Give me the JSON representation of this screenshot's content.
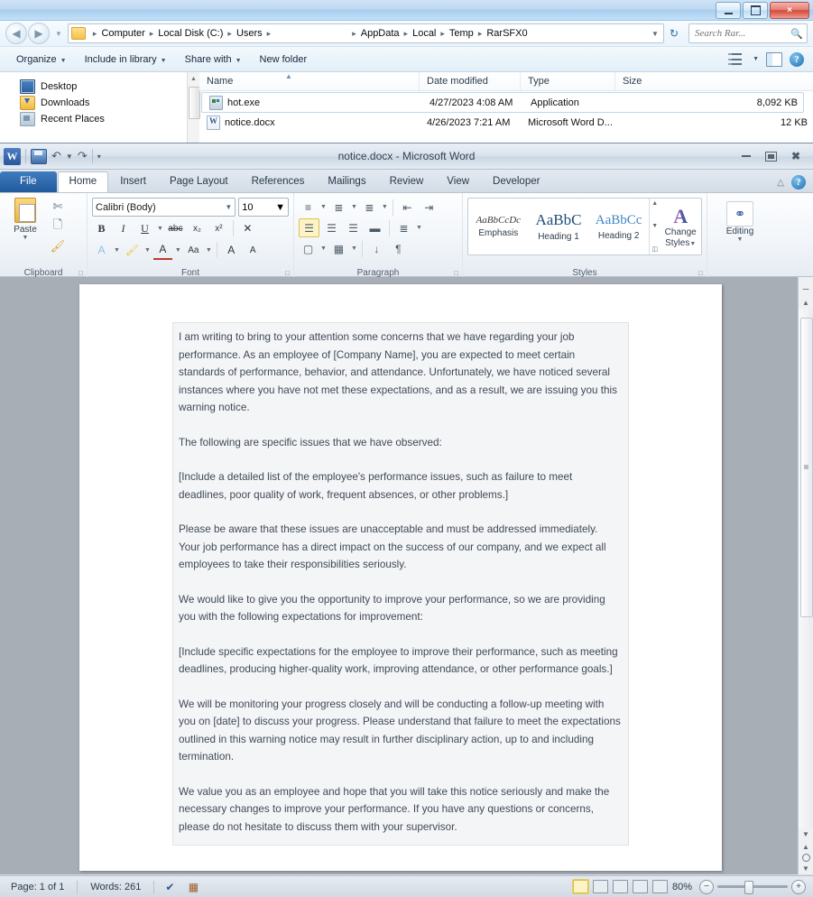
{
  "explorer": {
    "window_buttons": {
      "minimize": "minimize-button",
      "maximize": "maximize-button",
      "close": "×"
    },
    "breadcrumb": {
      "items": [
        "Computer",
        "Local Disk (C:)",
        "Users",
        "AppData",
        "Local",
        "Temp",
        "RarSFX0"
      ],
      "separator": "▸"
    },
    "search": {
      "placeholder": "Search Rar...",
      "value": ""
    },
    "toolbar": {
      "items": [
        {
          "label": "Organize",
          "has_caret": true
        },
        {
          "label": "Include in library",
          "has_caret": true
        },
        {
          "label": "Share with",
          "has_caret": true
        },
        {
          "label": "New folder",
          "has_caret": false
        }
      ],
      "help_label": "?"
    },
    "sidebar": {
      "items": [
        {
          "label": "Desktop",
          "icon": "desktop-icon"
        },
        {
          "label": "Downloads",
          "icon": "downloads-folder-icon"
        },
        {
          "label": "Recent Places",
          "icon": "recent-places-icon"
        }
      ]
    },
    "file_list": {
      "columns": [
        "Name",
        "Date modified",
        "Type",
        "Size"
      ],
      "rows": [
        {
          "name": "hot.exe",
          "date": "4/27/2023 4:08 AM",
          "type": "Application",
          "size": "8,092 KB",
          "icon": "executable-file-icon",
          "selected": true
        },
        {
          "name": "notice.docx",
          "date": "4/26/2023 7:21 AM",
          "type": "Microsoft Word D...",
          "size": "12 KB",
          "icon": "word-document-icon",
          "selected": false
        }
      ]
    }
  },
  "word": {
    "title": "notice.docx - Microsoft Word",
    "logo": "W",
    "quick_access": [
      "save-icon",
      "undo-icon",
      "redo-icon",
      "customize-icon"
    ],
    "tabs": [
      {
        "label": "File",
        "active": false,
        "is_file": true
      },
      {
        "label": "Home",
        "active": true,
        "is_file": false
      },
      {
        "label": "Insert",
        "active": false,
        "is_file": false
      },
      {
        "label": "Page Layout",
        "active": false,
        "is_file": false
      },
      {
        "label": "References",
        "active": false,
        "is_file": false
      },
      {
        "label": "Mailings",
        "active": false,
        "is_file": false
      },
      {
        "label": "Review",
        "active": false,
        "is_file": false
      },
      {
        "label": "View",
        "active": false,
        "is_file": false
      },
      {
        "label": "Developer",
        "active": false,
        "is_file": false
      }
    ],
    "ribbon": {
      "clipboard": {
        "group_label": "Clipboard",
        "paste_label": "Paste",
        "cut": "cut-icon",
        "copy": "copy-icon",
        "format_painter": "format-painter-icon"
      },
      "font": {
        "group_label": "Font",
        "font_name": "Calibri (Body)",
        "font_size": "10",
        "bold": "B",
        "italic": "I",
        "underline": "U",
        "strikethrough": "abc",
        "subscript": "x₂",
        "superscript": "x²",
        "clear_formatting": "clear-formatting-icon",
        "text_effects": "A",
        "highlight": "highlight-icon",
        "font_color": "A",
        "change_case": "Aa",
        "grow_font": "A",
        "shrink_font": "A"
      },
      "paragraph": {
        "group_label": "Paragraph",
        "bullets": "bullets-icon",
        "numbering": "numbering-icon",
        "multilevel": "multilevel-list-icon",
        "decrease_indent": "decrease-indent-icon",
        "increase_indent": "increase-indent-icon",
        "align_left": "align-left-icon",
        "align_center": "align-center-icon",
        "align_right": "align-right-icon",
        "justify": "justify-icon",
        "line_spacing": "line-spacing-icon",
        "shading": "shading-icon",
        "borders": "borders-icon",
        "sort": "sort-icon",
        "show_marks": "¶"
      },
      "styles": {
        "group_label": "Styles",
        "gallery": [
          {
            "preview": "AaBbCcDc",
            "name": "Emphasis"
          },
          {
            "preview": "AaBbC",
            "name": "Heading 1"
          },
          {
            "preview": "AaBbCc",
            "name": "Heading 2"
          }
        ],
        "change_styles_line1": "Change",
        "change_styles_line2": "Styles"
      },
      "editing": {
        "group_label": "Editing",
        "label": "Editing",
        "icon": "find-binoculars-icon"
      }
    },
    "document": {
      "paragraphs": [
        "I am writing to bring to your attention some concerns that we have regarding your job performance. As an employee of [Company Name], you are expected to meet certain standards of performance, behavior, and attendance. Unfortunately, we have noticed several instances where you have not met these expectations, and as a result, we are issuing you this warning notice.",
        "The following are specific issues that we have observed:",
        "[Include a detailed list of the employee's performance issues, such as failure to meet deadlines, poor quality of work, frequent absences, or other problems.]",
        "Please be aware that these issues are unacceptable and must be addressed immediately. Your job performance has a direct impact on the success of our company, and we expect all employees to take their responsibilities seriously.",
        "We would like to give you the opportunity to improve your performance, so we are providing you with the following expectations for improvement:",
        "[Include specific expectations for the employee to improve their performance, such as meeting deadlines, producing higher-quality work, improving attendance, or other performance goals.]",
        "We will be monitoring your progress closely and will be conducting a follow-up meeting with you on [date] to discuss your progress. Please understand that failure to meet the expectations outlined in this warning notice may result in further disciplinary action, up to and including termination.",
        "We value you as an employee and hope that you will take this notice seriously and make the necessary changes to improve your performance. If you have any questions or concerns, please do not hesitate to discuss them with your supervisor."
      ]
    },
    "status_bar": {
      "page": "Page: 1 of 1",
      "words": "Words: 261",
      "proofing_icon": "spell-check-icon",
      "language_icon": "language-icon",
      "zoom_level": "80%",
      "zoom_out": "−",
      "zoom_in": "+",
      "view_buttons": [
        "print-layout-view",
        "full-screen-reading-view",
        "web-layout-view",
        "outline-view",
        "draft-view"
      ]
    }
  },
  "colors": {
    "accent_blue": "#2b579a",
    "explorer_chrome": "#e9f3fb",
    "selection_border": "#b9d7ee",
    "doc_background": "#a8aeb6",
    "text_block_bg": "#f4f5f7"
  }
}
